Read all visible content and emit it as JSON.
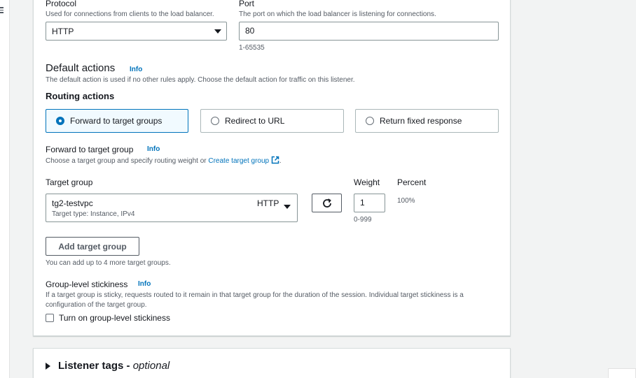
{
  "protocol": {
    "label": "Protocol",
    "description": "Used for connections from clients to the load balancer.",
    "value": "HTTP"
  },
  "port": {
    "label": "Port",
    "description": "The port on which the load balancer is listening for connections.",
    "value": "80",
    "range": "1-65535"
  },
  "default_actions": {
    "heading": "Default actions",
    "info": "Info",
    "description": "The default action is used if no other rules apply. Choose the default action for traffic on this listener."
  },
  "routing_actions": {
    "heading": "Routing actions",
    "options": [
      {
        "label": "Forward to target groups",
        "selected": true
      },
      {
        "label": "Redirect to URL",
        "selected": false
      },
      {
        "label": "Return fixed response",
        "selected": false
      }
    ]
  },
  "forward": {
    "label": "Forward to target group",
    "info": "Info",
    "description": "Choose a target group and specify routing weight or",
    "create_link": "Create target group",
    "trailing": "."
  },
  "target_group": {
    "label": "Target group",
    "name": "tg2-testvpc",
    "protocol": "HTTP",
    "type": "Target type: Instance, IPv4"
  },
  "weight": {
    "label": "Weight",
    "value": "1",
    "range": "0-999"
  },
  "percent": {
    "label": "Percent",
    "value": "100%"
  },
  "add_target_group": {
    "button": "Add target group",
    "hint": "You can add up to 4 more target groups."
  },
  "stickiness": {
    "label": "Group-level stickiness",
    "info": "Info",
    "description": "If a target group is sticky, requests routed to it remain in that target group for the duration of the session. Individual target stickiness is a configuration of the target group.",
    "checkbox_label": "Turn on group-level stickiness",
    "checked": false
  },
  "listener_tags": {
    "title": "Listener tags - ",
    "optional": "optional"
  },
  "colors": {
    "accent": "#0073bb",
    "selected_bg": "#f1faff"
  },
  "icons": [
    "menu-icon",
    "chevron-down-icon",
    "refresh-icon",
    "external-link-icon",
    "caret-right-icon"
  ]
}
